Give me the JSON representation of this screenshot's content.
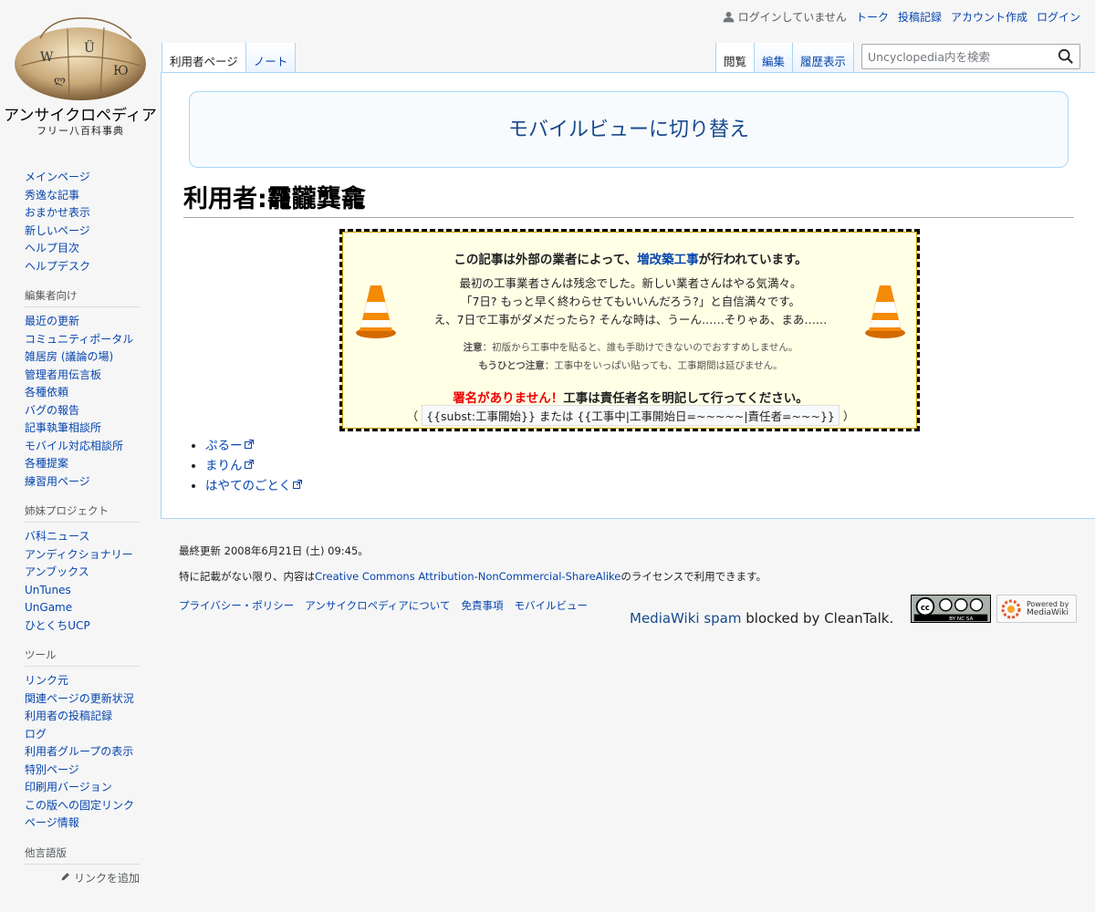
{
  "logo": {
    "site_name": "アンサイクロペディア",
    "tagline": "フリー八百科事典"
  },
  "personal": {
    "not_logged_in": "ログインしていません",
    "talk": "トーク",
    "contributions": "投稿記録",
    "create_account": "アカウント作成",
    "login": "ログイン"
  },
  "tabs": {
    "left": [
      "利用者ページ",
      "ノート"
    ],
    "right": [
      "閲覧",
      "編集",
      "履歴表示"
    ]
  },
  "search": {
    "placeholder": "Uncyclopedia内を検索"
  },
  "sidebar": {
    "nav": [
      "メインページ",
      "秀逸な記事",
      "おまかせ表示",
      "新しいページ",
      "ヘルプ目次",
      "ヘルプデスク"
    ],
    "editors": {
      "heading": "編集者向け",
      "items": [
        "最近の更新",
        "コミュニティポータル",
        "雑居房 (議論の場)",
        "管理者用伝言板",
        "各種依頼",
        "バグの報告",
        "記事執筆相談所",
        "モバイル対応相談所",
        "各種提案",
        "練習用ページ"
      ]
    },
    "sister": {
      "heading": "姉妹プロジェクト",
      "items": [
        "バ科ニュース",
        "アンディクショナリー",
        "アンブックス",
        "UnTunes",
        "UnGame",
        "ひとくちUCP"
      ]
    },
    "tools": {
      "heading": "ツール",
      "items": [
        "リンク元",
        "関連ページの更新状況",
        "利用者の投稿記録",
        "ログ",
        "利用者グループの表示",
        "特別ページ",
        "印刷用バージョン",
        "この版への固定リンク",
        "ページ情報"
      ]
    },
    "languages": {
      "heading": "他言語版",
      "add_links": "リンクを追加"
    }
  },
  "content": {
    "mobile_switch": "モバイルビューに切り替え",
    "title": "利用者:龗龖龔龕",
    "notice": {
      "title_pre": "この記事は外部の業者によって、",
      "title_link": "増改築工事",
      "title_post": "が行われています。",
      "line1": "最初の工事業者さんは残念でした。新しい業者さんはやる気満々。",
      "line2": "「7日? もっと早く終わらせてもいいんだろう?」と自信満々です。",
      "line3": "え、7日で工事がダメだったら? そんな時は、うーん……そりゃあ、まあ……",
      "note1_label": "注意",
      "note1": "：初版から工事中を貼ると、誰も手助けできないのでおすすめしません。",
      "note2_label": "もうひとつ注意",
      "note2": "：工事中をいっぱい貼っても、工事期間は延びません。",
      "sign_warn": "署名がありません！",
      "sign_text": "工事は責任者名を明記して行ってください。",
      "code_open": "（",
      "code": "{{subst:工事開始}} または {{工事中|工事開始日=~~~~~|責任者=~~~}}",
      "code_close": "）"
    },
    "links": [
      "ぷるー",
      "まりん",
      "はやてのごとく"
    ]
  },
  "footer": {
    "last_modified": "最終更新 2008年6月21日 (土) 09:45。",
    "license_pre": "特に記載がない限り、内容は",
    "license_link": "Creative Commons Attribution-NonCommercial-ShareAlike",
    "license_post": "のライセンスで利用できます。",
    "places": [
      "プライバシー・ポリシー",
      "アンサイクロペディアについて",
      "免責事項",
      "モバイルビュー"
    ],
    "spam_link": "MediaWiki spam",
    "spam_text": " blocked by CleanTalk.",
    "cc_label": "BY NC SA",
    "mw_label1": "Powered by",
    "mw_label2": "MediaWiki"
  }
}
